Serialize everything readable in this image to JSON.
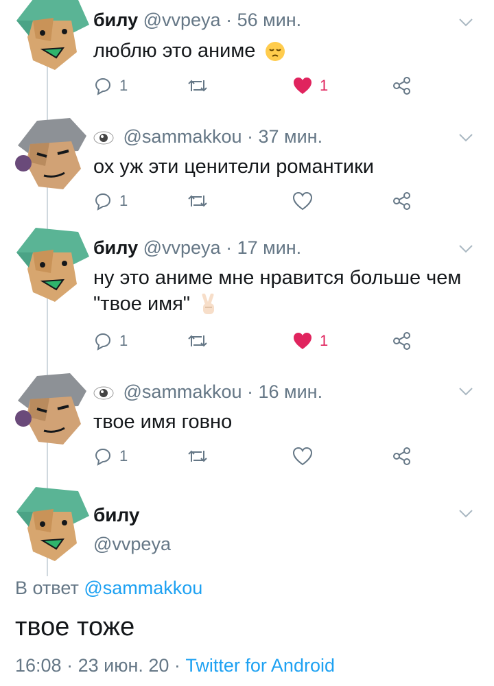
{
  "tweets": [
    {
      "display_name": "билу",
      "handle": "@vvpeya",
      "time": "56 мин.",
      "text": "люблю это аниме",
      "replies": "1",
      "likes": "1",
      "liked": true,
      "emoji": "pensive-face"
    },
    {
      "display_name": "",
      "handle": "@sammakkou",
      "time": "37 мин.",
      "text": "ох уж эти ценители романтики",
      "replies": "1",
      "likes": "",
      "liked": false
    },
    {
      "display_name": "билу",
      "handle": "@vvpeya",
      "time": "17 мин.",
      "text": "ну это аниме мне нравится больше чем \"твое имя\"",
      "replies": "1",
      "likes": "1",
      "liked": true,
      "emoji": "victory-hand"
    },
    {
      "display_name": "",
      "handle": "@sammakkou",
      "time": "16 мин.",
      "text": "твое имя говно",
      "replies": "1",
      "likes": "",
      "liked": false
    }
  ],
  "main_tweet": {
    "display_name": "билу",
    "handle": "@vvpeya",
    "reply_prefix": "В ответ",
    "reply_to": "@sammakkou",
    "text": "твое тоже",
    "time": "16:08",
    "date": "23 июн. 20",
    "source": "Twitter for Android",
    "separator": " · "
  },
  "colors": {
    "secondary_text": "#657786",
    "link": "#1da1f2",
    "like": "#e0245e",
    "divider": "#cfd8de"
  },
  "icons": [
    "caret-down-icon",
    "reply-icon",
    "retweet-icon",
    "like-icon",
    "share-icon",
    "eye-icon"
  ]
}
